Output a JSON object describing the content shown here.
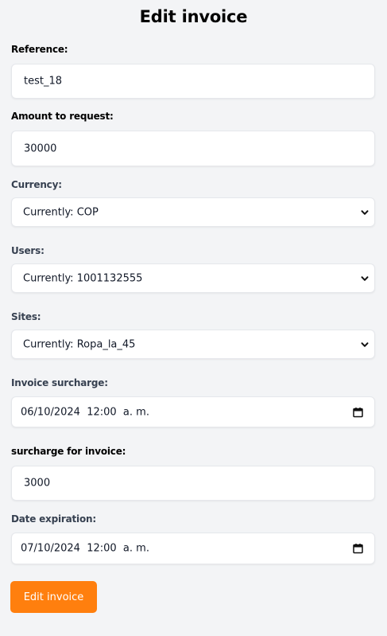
{
  "page": {
    "title": "Edit invoice"
  },
  "form": {
    "reference": {
      "label": "Reference:",
      "value": "test_18"
    },
    "amount": {
      "label": "Amount to request:",
      "value": "30000"
    },
    "currency": {
      "label": "Currency:",
      "value": "Currently: COP"
    },
    "users": {
      "label": "Users:",
      "value": "Currently: 1001132555"
    },
    "sites": {
      "label": "Sites:",
      "value": "Currently: Ropa_la_45"
    },
    "invoice_surcharge": {
      "label": "Invoice surcharge:",
      "value": "06/10/2024  12:00  a. m."
    },
    "surcharge_for_invoice": {
      "label": "surcharge for invoice:",
      "value": "3000"
    },
    "date_expiration": {
      "label": "Date expiration:",
      "value": "07/10/2024  12:00  a. m."
    },
    "submit_label": "Edit invoice"
  },
  "colors": {
    "background": "#f3f4f6",
    "accent": "#ff7f0e"
  },
  "icons": {
    "select": "chevron-down-icon",
    "date": "calendar-icon"
  }
}
